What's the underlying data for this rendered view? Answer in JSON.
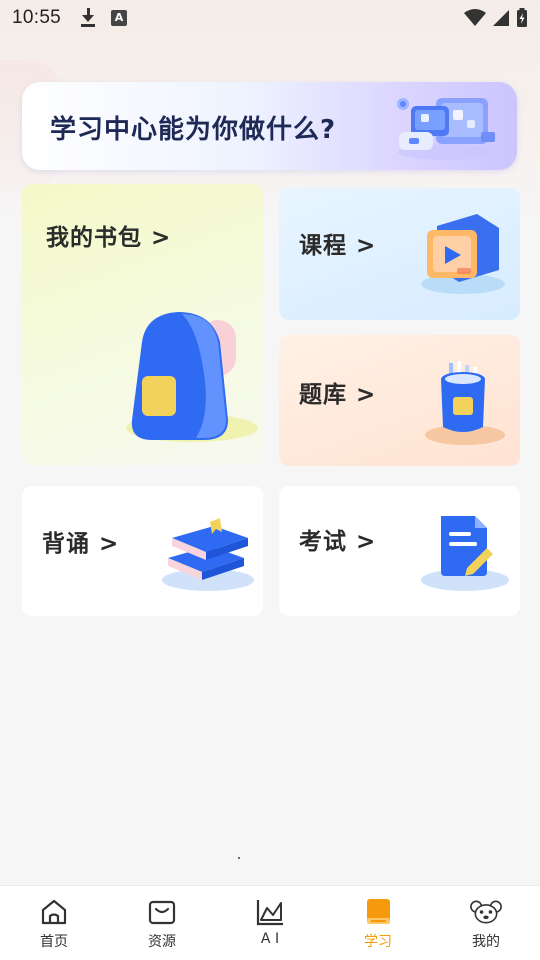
{
  "status_bar": {
    "time": "10:55",
    "left_icons": [
      "download-icon",
      "a-text-icon"
    ],
    "right_icons": [
      "wifi-icon",
      "signal-icon",
      "battery-charging-icon"
    ]
  },
  "banner": {
    "title": "学习中心能为你做什么?"
  },
  "cards": {
    "bag": {
      "label": "我的书包 >",
      "icon": "backpack-icon"
    },
    "course": {
      "label": "课程 >",
      "icon": "video-screen-icon"
    },
    "bank": {
      "label": "题库 >",
      "icon": "pencil-cup-icon"
    },
    "recite": {
      "label": "背诵 >",
      "icon": "book-stack-icon"
    },
    "exam": {
      "label": "考试 >",
      "icon": "exam-paper-icon"
    }
  },
  "nav": {
    "items": [
      {
        "label": "首页",
        "icon": "home-icon",
        "active": false
      },
      {
        "label": "资源",
        "icon": "bag-icon",
        "active": false
      },
      {
        "label": "A I",
        "icon": "chart-icon",
        "active": false
      },
      {
        "label": "学习",
        "icon": "book-icon",
        "active": true
      },
      {
        "label": "我的",
        "icon": "mouse-avatar-icon",
        "active": false
      }
    ]
  },
  "colors": {
    "accent": "#f59a0c",
    "banner_title": "#1e2a55",
    "icon_blue": "#2f6bf2"
  }
}
